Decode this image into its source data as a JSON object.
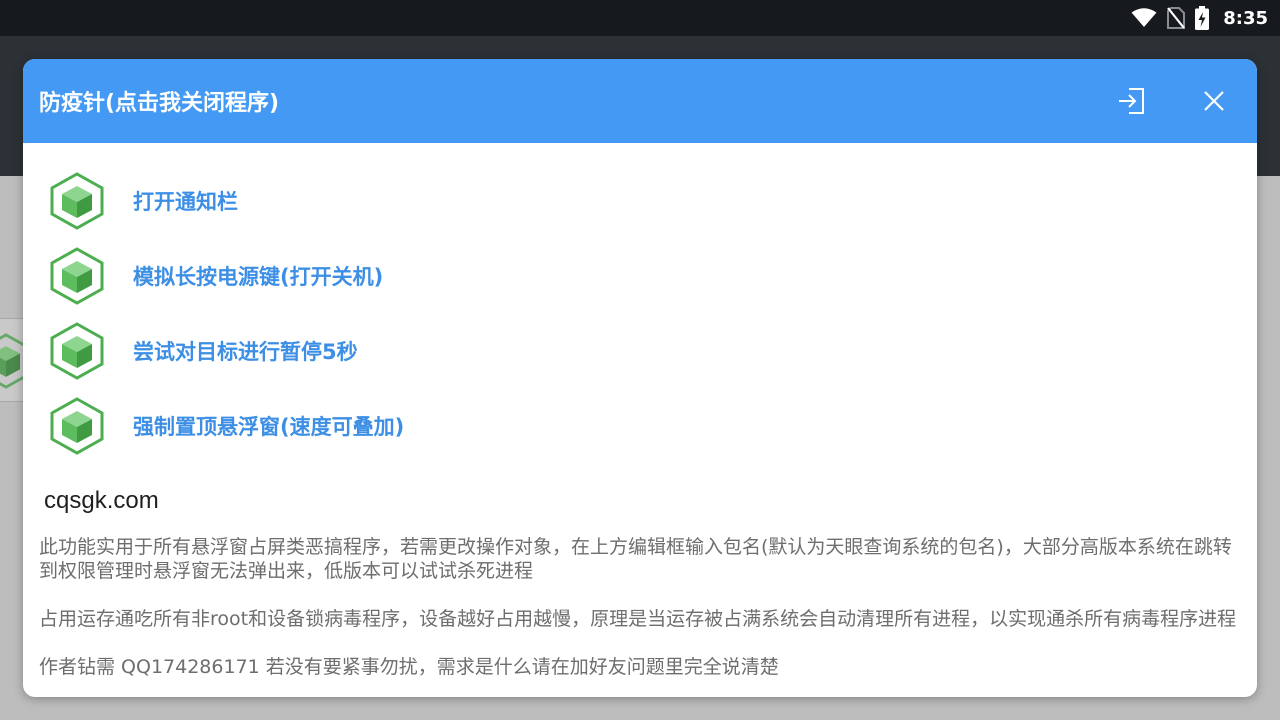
{
  "status_bar": {
    "time": "8:35",
    "icons": [
      "wifi-icon",
      "no-sim-icon",
      "battery-charging-icon"
    ]
  },
  "dialog": {
    "title": "防疫针(点击我关闭程序)",
    "header_buttons": [
      "exit-icon",
      "close-icon"
    ],
    "menu_items": [
      {
        "label": "打开通知栏",
        "icon": "cube-icon"
      },
      {
        "label": "模拟长按电源键(打开关机)",
        "icon": "cube-icon"
      },
      {
        "label": "尝试对目标进行暂停5秒",
        "icon": "cube-icon"
      },
      {
        "label": "强制置顶悬浮窗(速度可叠加)",
        "icon": "cube-icon"
      }
    ],
    "site": "cqsgk.com",
    "descriptions": [
      "此功能实用于所有悬浮窗占屏类恶搞程序，若需更改操作对象，在上方编辑框输入包名(默认为天眼查询系统的包名)，大部分高版本系统在跳转到权限管理时悬浮窗无法弹出来，低版本可以试试杀死进程",
      "占用运存通吃所有非root和设备锁病毒程序，设备越好占用越慢，原理是当运存被占满系统会自动清理所有进程，以实现通杀所有病毒程序进程",
      "作者钻需  QQ174286171 若没有要紧事勿扰，需求是什么请在加好友问题里完全说清楚"
    ]
  },
  "colors": {
    "header": "#4399f3",
    "item_label": "#3d8fe6",
    "icon_green": "#4cae4f",
    "status_bar": "#161a1e"
  }
}
